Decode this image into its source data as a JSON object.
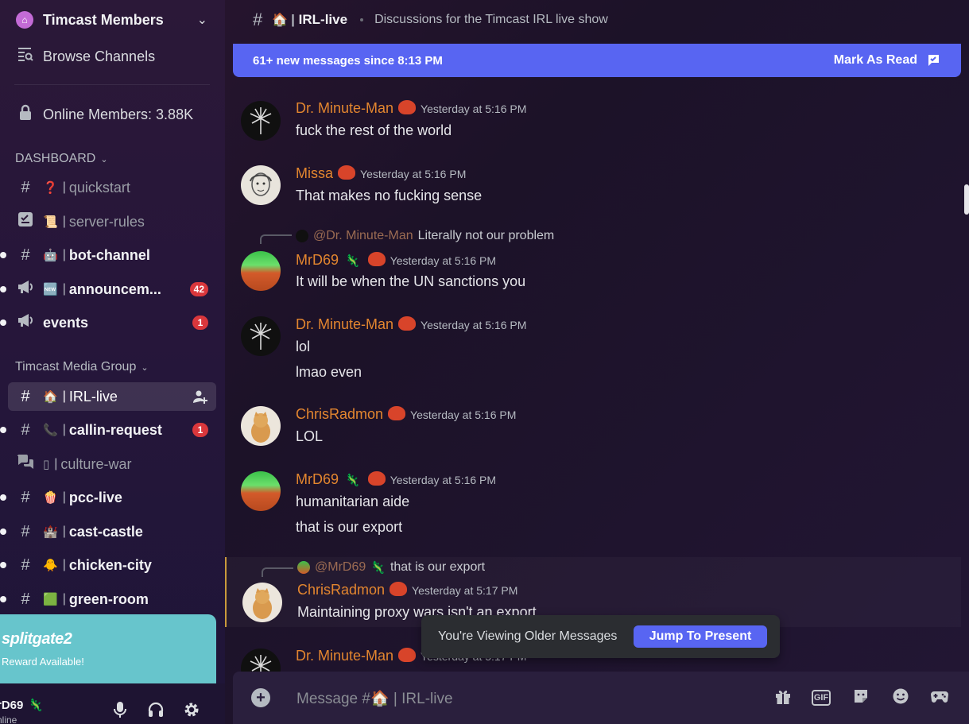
{
  "server": {
    "name": "Timcast Members",
    "icon": "house-icon"
  },
  "sidebar": {
    "browse": "Browse Channels",
    "online": "Online Members: 3.88K",
    "categories": {
      "dashboard": "DASHBOARD",
      "media": "Timcast Media Group"
    },
    "channels": [
      {
        "emoji": "❓",
        "label": "quickstart"
      },
      {
        "emoji": "📜",
        "label": "server-rules"
      },
      {
        "emoji": "🤖",
        "label": "bot-channel"
      },
      {
        "emoji": "🆕",
        "label": "announcem...",
        "badge": "42"
      },
      {
        "label": "events",
        "badge": "1"
      },
      {
        "emoji": "🏠",
        "label": "IRL-live"
      },
      {
        "emoji": "📞",
        "label": "callin-request",
        "badge": "1"
      },
      {
        "emoji": "▯",
        "label": "culture-war"
      },
      {
        "emoji": "🍿",
        "label": "pcc-live"
      },
      {
        "emoji": "🏰",
        "label": "cast-castle"
      },
      {
        "emoji": "🐥",
        "label": "chicken-city"
      },
      {
        "emoji": "🟩",
        "label": "green-room"
      }
    ]
  },
  "promo": {
    "brand": "splitgate2",
    "text": "Reward Available!"
  },
  "user": {
    "name": "rD69",
    "status": "nline"
  },
  "topbar": {
    "emoji": "🏠",
    "channel": "IRL-live",
    "topic": "Discussions for the Timcast IRL live show"
  },
  "newbar": {
    "text": "61+ new messages since 8:13 PM",
    "mark": "Mark As Read"
  },
  "messages": [
    {
      "author": "Dr. Minute-Man",
      "time": "Yesterday at 5:16 PM",
      "lines": [
        "fuck the rest of the world"
      ]
    },
    {
      "author": "Missa",
      "time": "Yesterday at 5:16 PM",
      "lines": [
        "That makes no fucking sense"
      ]
    },
    {
      "reply_mention": "@Dr. Minute-Man",
      "reply_text": "Literally not our problem",
      "author": "MrD69",
      "time": "Yesterday at 5:16 PM",
      "lines": [
        "It will be when the UN sanctions you"
      ]
    },
    {
      "author": "Dr. Minute-Man",
      "time": "Yesterday at 5:16 PM",
      "lines": [
        "lol",
        "lmao even"
      ]
    },
    {
      "author": "ChrisRadmon",
      "time": "Yesterday at 5:16 PM",
      "lines": [
        "LOL"
      ]
    },
    {
      "author": "MrD69",
      "time": "Yesterday at 5:16 PM",
      "lines": [
        "humanitarian aide",
        "that is our export"
      ]
    },
    {
      "reply_mention": "@MrD69",
      "reply_text": "that is our export",
      "author": "ChrisRadmon",
      "time": "Yesterday at 5:17 PM",
      "lines": [
        "Maintaining proxy wars isn't an export"
      ]
    },
    {
      "author": "Dr. Minute-Man",
      "time": "Yesterday at 5:17 PM"
    }
  ],
  "older": {
    "text": "You're Viewing Older Messages",
    "button": "Jump To Present"
  },
  "composer": {
    "prefix": "Message #",
    "emoji": "🏠",
    "channel": "| IRL-live",
    "gif": "GIF"
  },
  "colors": {
    "accent": "#5865f2",
    "author": "#e3862f",
    "badge": "#da373c",
    "promo": "#67c5cc"
  }
}
